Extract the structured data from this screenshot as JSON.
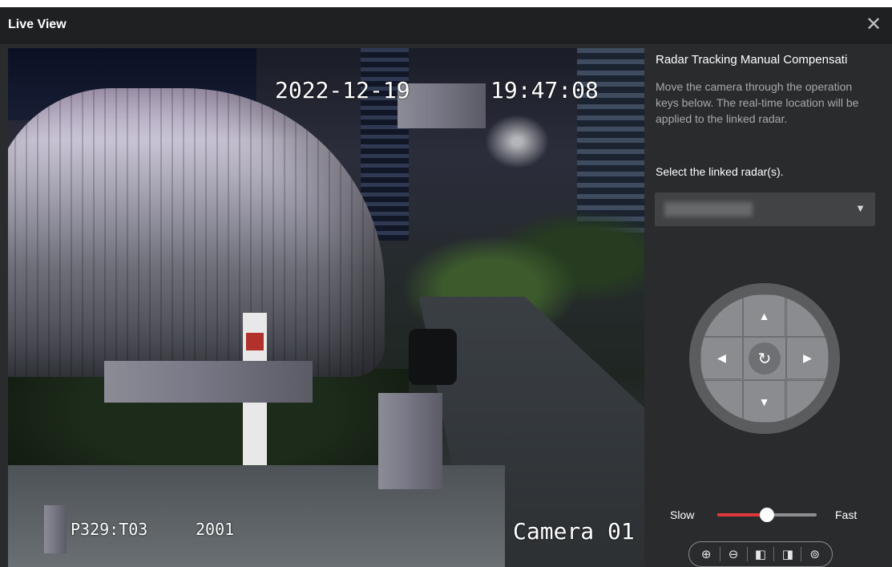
{
  "window": {
    "title": "Live View",
    "close_icon": "close-icon"
  },
  "video": {
    "osd_date": "2022-12-19",
    "osd_time": "19:47:08",
    "osd_position": "P329:T03",
    "osd_number": "2001",
    "osd_camera": "Camera 01"
  },
  "panel": {
    "title": "Radar Tracking Manual Compensati",
    "description": "Move the camera through the operation keys below. The real-time location will be applied to the linked radar.",
    "select_label": "Select the linked radar(s).",
    "select_arrow_icon": "chevron-down-icon",
    "ptz": {
      "up_glyph": "▲",
      "down_glyph": "▼",
      "left_glyph": "◀",
      "right_glyph": "▶",
      "center_glyph": "↻",
      "diag_glyph": "·"
    },
    "speed": {
      "slow_label": "Slow",
      "fast_label": "Fast",
      "value": 0.5
    },
    "toolbar": {
      "zoom_in": "⊕",
      "zoom_out": "⊖",
      "focus_near": "◧",
      "focus_far": "◨",
      "three_d": "⊚"
    }
  },
  "colors": {
    "accent": "#e0383a",
    "panel_bg": "#2a2b2d",
    "titlebar_bg": "#1f2022"
  }
}
